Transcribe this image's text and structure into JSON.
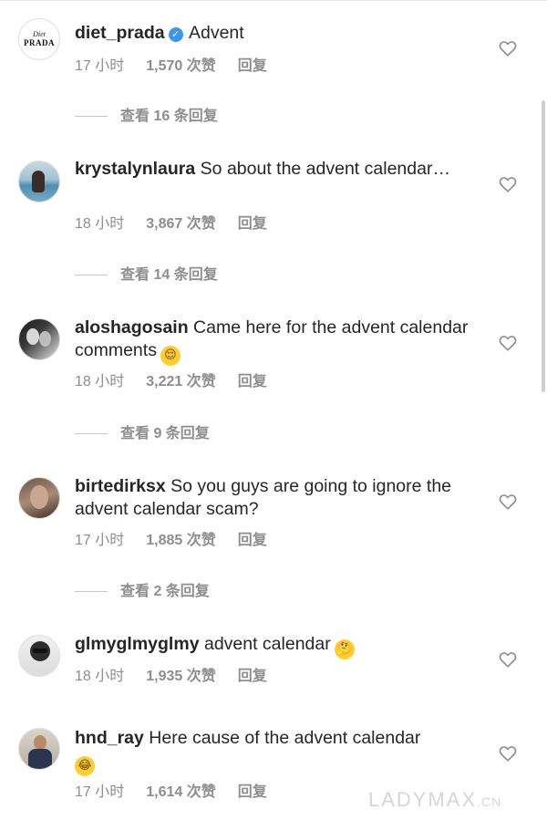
{
  "comments": [
    {
      "username": "diet_prada",
      "verified": true,
      "text": "Advent",
      "time": "17 小时",
      "likes": "1,570 次赞",
      "reply": "回复",
      "view_replies": "查看 16 条回复",
      "avatar_label_1": "Diet",
      "avatar_label_2": "PRADA"
    },
    {
      "username": "krystalynlaura",
      "text": "So about the advent calendar…",
      "time": "18 小时",
      "likes": "3,867 次赞",
      "reply": "回复",
      "view_replies": "查看 14 条回复"
    },
    {
      "username": "aloshagosain",
      "text": "Came here for the advent calendar comments",
      "emoji": "😌",
      "time": "18 小时",
      "likes": "3,221 次赞",
      "reply": "回复",
      "view_replies": "查看 9 条回复"
    },
    {
      "username": "birtedirksx",
      "text": "So you guys are going to ignore the advent calendar scam?",
      "time": "17 小时",
      "likes": "1,885 次赞",
      "reply": "回复",
      "view_replies": "查看 2 条回复"
    },
    {
      "username": "glmyglmyglmy",
      "text": "advent calendar",
      "emoji": "🤔",
      "time": "18 小时",
      "likes": "1,935 次赞",
      "reply": "回复"
    },
    {
      "username": "hnd_ray",
      "text": "Here cause of the advent calendar",
      "emoji": "😂",
      "time": "17 小时",
      "likes": "1,614 次赞",
      "reply": "回复"
    }
  ],
  "icons": {
    "like": "heart-outline-icon",
    "verified": "verified-badge-icon"
  },
  "colors": {
    "verified": "#3897f0",
    "meta": "#8e8e8e",
    "text": "#262626"
  },
  "watermark": {
    "main": "LADYMAX",
    "suffix": ".CN"
  }
}
